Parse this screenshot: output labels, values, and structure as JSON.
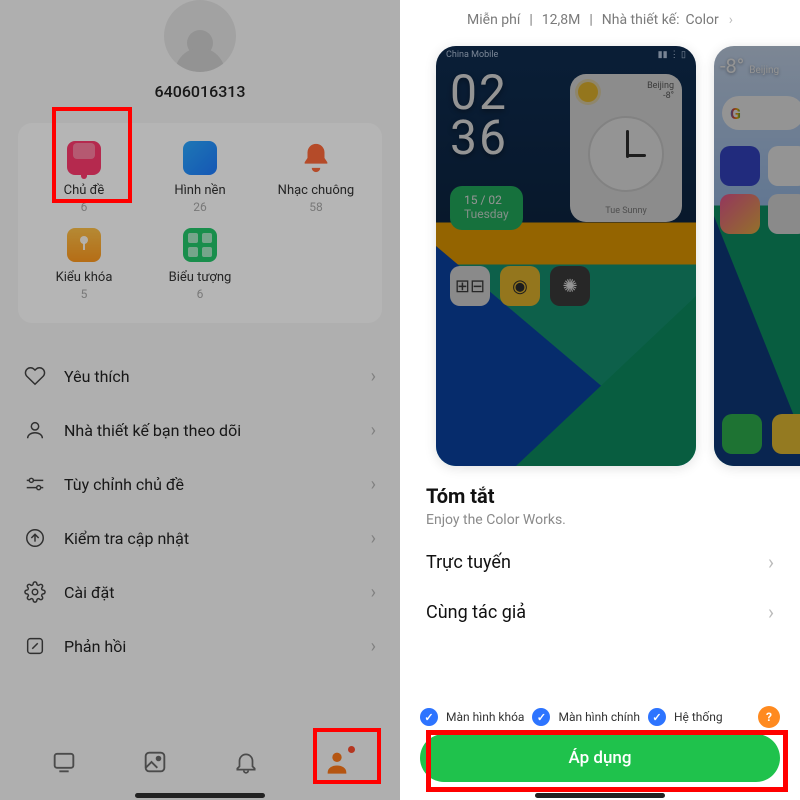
{
  "left": {
    "user_id": "6406016313",
    "tiles": [
      {
        "label": "Chủ đề",
        "count": "6"
      },
      {
        "label": "Hình nền",
        "count": "26"
      },
      {
        "label": "Nhạc chuông",
        "count": "58"
      },
      {
        "label": "Kiểu khóa",
        "count": "5"
      },
      {
        "label": "Biểu tượng",
        "count": "6"
      }
    ],
    "menu": {
      "favorites": "Yêu thích",
      "following": "Nhà thiết kế bạn theo dõi",
      "customize": "Tùy chỉnh chủ đề",
      "update": "Kiểm tra cập nhật",
      "settings": "Cài đặt",
      "feedback": "Phản hồi"
    }
  },
  "right": {
    "meta": {
      "free": "Miễn phí",
      "size": "12,8M",
      "designer_label": "Nhà thiết kế:",
      "designer_value": "Color"
    },
    "preview1": {
      "status_left": "China Mobile",
      "clock_top": "02",
      "clock_bot": "36",
      "widget_city": "Beijing",
      "widget_temp": "-8°",
      "widget_day": "Tue Sunny",
      "date_line1": "15 / 02",
      "date_line2": "Tuesday"
    },
    "preview2": {
      "temp": "-8°",
      "city": "Beijing"
    },
    "summary": {
      "title": "Tóm tắt",
      "desc": "Enjoy the Color Works."
    },
    "sections": {
      "online": "Trực tuyến",
      "same_author": "Cùng tác giả"
    },
    "apply": {
      "opt1": "Màn hình khóa",
      "opt2": "Màn hình chính",
      "opt3": "Hệ thống",
      "help": "?",
      "button": "Áp dụng"
    }
  }
}
